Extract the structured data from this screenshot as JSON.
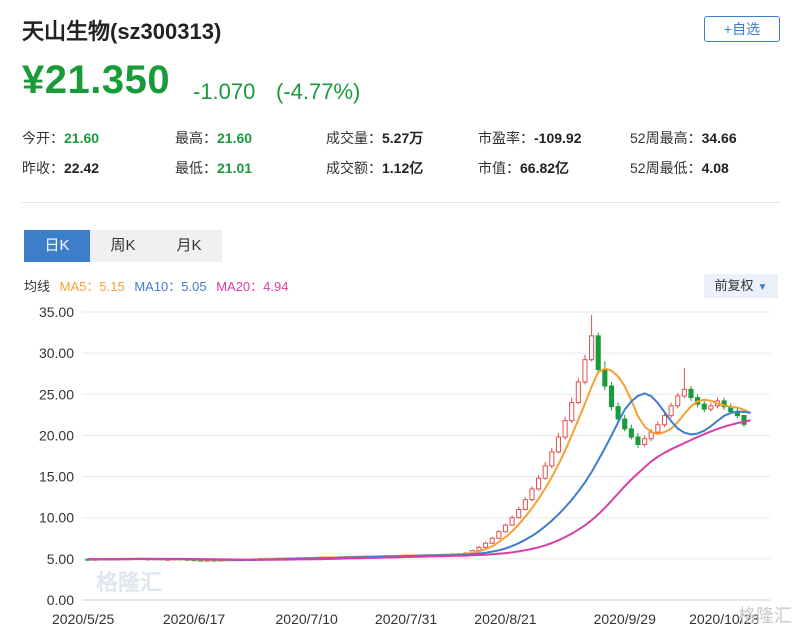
{
  "header": {
    "title": "天山生物(sz300313)",
    "watch_label": "+自选",
    "price": "¥21.350",
    "change": "-1.070",
    "change_pct": "(-4.77%)"
  },
  "stats": [
    {
      "label": "今开：",
      "value": "21.60",
      "color": "#1a9b3a"
    },
    {
      "label": "最高：",
      "value": "21.60",
      "color": "#1a9b3a"
    },
    {
      "label": "成交量：",
      "value": "5.27万",
      "color": "#222222"
    },
    {
      "label": "市盈率：",
      "value": "-109.92",
      "color": "#222222"
    },
    {
      "label": "52周最高：",
      "value": "34.66",
      "color": "#222222"
    },
    {
      "label": "昨收：",
      "value": "22.42",
      "color": "#222222"
    },
    {
      "label": "最低：",
      "value": "21.01",
      "color": "#1a9b3a"
    },
    {
      "label": "成交额：",
      "value": "1.12亿",
      "color": "#222222"
    },
    {
      "label": "市值：",
      "value": "66.82亿",
      "color": "#222222"
    },
    {
      "label": "52周最低：",
      "value": "4.08",
      "color": "#222222"
    }
  ],
  "tabs": [
    "日K",
    "周K",
    "月K"
  ],
  "legend": {
    "label": "均线",
    "ma5": "MA5：5.15",
    "ma10": "MA10：5.05",
    "ma20": "MA20：4.94",
    "ma5_color": "#f5a033",
    "ma10_color": "#3d7ecb",
    "ma20_color": "#d63fa8"
  },
  "adjust_label": "前复权",
  "watermarks": [
    "格隆汇",
    "格隆汇"
  ],
  "chart_data": {
    "type": "candlestick",
    "yticks": [
      "35.00",
      "30.00",
      "25.00",
      "20.00",
      "15.00",
      "10.00",
      "5.00",
      "0.00"
    ],
    "ylim": [
      0,
      35
    ],
    "xticks": [
      {
        "label": "2020/5/25",
        "i": 0
      },
      {
        "label": "2020/6/17",
        "i": 16
      },
      {
        "label": "2020/7/10",
        "i": 33
      },
      {
        "label": "2020/7/31",
        "i": 48
      },
      {
        "label": "2020/8/21",
        "i": 63
      },
      {
        "label": "2020/9/29",
        "i": 81
      },
      {
        "label": "2020/10/28",
        "i": 96
      }
    ],
    "candles": [
      [
        4.95,
        4.9,
        5.05,
        4.85
      ],
      [
        4.9,
        4.95,
        5.0,
        4.85
      ],
      [
        4.95,
        5.0,
        5.05,
        4.9
      ],
      [
        5.0,
        4.95,
        5.05,
        4.9
      ],
      [
        4.95,
        5.0,
        5.05,
        4.9
      ],
      [
        5.0,
        5.05,
        5.1,
        4.95
      ],
      [
        5.05,
        5.0,
        5.1,
        4.95
      ],
      [
        5.0,
        5.05,
        5.1,
        4.95
      ],
      [
        5.05,
        5.0,
        5.1,
        4.95
      ],
      [
        5.0,
        4.95,
        5.05,
        4.9
      ],
      [
        4.95,
        5.0,
        5.05,
        4.9
      ],
      [
        5.0,
        4.95,
        5.05,
        4.9
      ],
      [
        4.95,
        4.95,
        5.0,
        4.9
      ],
      [
        4.95,
        5.0,
        5.05,
        4.9
      ],
      [
        5.0,
        4.95,
        5.05,
        4.9
      ],
      [
        4.95,
        4.9,
        5.0,
        4.85
      ],
      [
        4.9,
        4.85,
        4.95,
        4.8
      ],
      [
        4.85,
        4.8,
        4.9,
        4.75
      ],
      [
        4.8,
        4.85,
        4.9,
        4.75
      ],
      [
        4.85,
        4.8,
        4.9,
        4.75
      ],
      [
        4.8,
        4.85,
        4.9,
        4.75
      ],
      [
        4.85,
        4.9,
        4.95,
        4.8
      ],
      [
        4.9,
        4.85,
        4.95,
        4.8
      ],
      [
        4.85,
        4.9,
        4.95,
        4.8
      ],
      [
        4.9,
        4.95,
        5.0,
        4.85
      ],
      [
        4.95,
        5.0,
        5.05,
        4.9
      ],
      [
        5.0,
        5.05,
        5.1,
        4.95
      ],
      [
        5.05,
        5.0,
        5.1,
        4.95
      ],
      [
        5.0,
        5.05,
        5.1,
        4.95
      ],
      [
        5.05,
        5.1,
        5.15,
        5.0
      ],
      [
        5.1,
        5.05,
        5.15,
        5.0
      ],
      [
        5.05,
        5.1,
        5.15,
        5.0
      ],
      [
        5.1,
        5.15,
        5.2,
        5.05
      ],
      [
        5.15,
        5.1,
        5.2,
        5.05
      ],
      [
        5.1,
        5.15,
        5.2,
        5.05
      ],
      [
        5.15,
        5.2,
        5.25,
        5.1
      ],
      [
        5.2,
        5.15,
        5.25,
        5.1
      ],
      [
        5.15,
        5.2,
        5.25,
        5.1
      ],
      [
        5.2,
        5.25,
        5.3,
        5.15
      ],
      [
        5.25,
        5.3,
        5.35,
        5.2
      ],
      [
        5.3,
        5.25,
        5.35,
        5.2
      ],
      [
        5.25,
        5.3,
        5.35,
        5.2
      ],
      [
        5.3,
        5.35,
        5.4,
        5.25
      ],
      [
        5.35,
        5.3,
        5.4,
        5.25
      ],
      [
        5.3,
        5.35,
        5.4,
        5.25
      ],
      [
        5.35,
        5.4,
        5.45,
        5.3
      ],
      [
        5.4,
        5.35,
        5.45,
        5.3
      ],
      [
        5.35,
        5.4,
        5.45,
        5.3
      ],
      [
        5.4,
        5.45,
        5.5,
        5.35
      ],
      [
        5.45,
        5.4,
        5.5,
        5.35
      ],
      [
        5.4,
        5.45,
        5.5,
        5.35
      ],
      [
        5.45,
        5.5,
        5.55,
        5.4
      ],
      [
        5.5,
        5.45,
        5.55,
        5.4
      ],
      [
        5.45,
        5.5,
        5.55,
        5.4
      ],
      [
        5.5,
        5.55,
        5.6,
        5.45
      ],
      [
        5.55,
        5.6,
        5.7,
        5.5
      ],
      [
        5.6,
        5.55,
        5.7,
        5.5
      ],
      [
        5.55,
        5.7,
        5.8,
        5.5
      ],
      [
        5.7,
        6.0,
        6.1,
        5.65
      ],
      [
        6.0,
        6.4,
        6.6,
        5.95
      ],
      [
        6.4,
        6.9,
        7.1,
        6.3
      ],
      [
        6.9,
        7.5,
        7.7,
        6.8
      ],
      [
        7.5,
        8.3,
        8.5,
        7.4
      ],
      [
        8.3,
        9.1,
        9.3,
        8.2
      ],
      [
        9.1,
        10.0,
        10.3,
        9.0
      ],
      [
        10.0,
        11.0,
        11.3,
        9.9
      ],
      [
        11.0,
        12.2,
        12.5,
        10.9
      ],
      [
        12.2,
        13.5,
        13.8,
        12.0
      ],
      [
        13.5,
        14.8,
        15.2,
        13.3
      ],
      [
        14.8,
        16.3,
        16.8,
        14.6
      ],
      [
        16.3,
        18.0,
        18.5,
        16.0
      ],
      [
        18.0,
        19.8,
        20.3,
        17.8
      ],
      [
        19.8,
        21.8,
        22.3,
        19.5
      ],
      [
        21.8,
        24.0,
        24.6,
        21.5
      ],
      [
        24.0,
        26.5,
        27.0,
        23.8
      ],
      [
        26.5,
        29.2,
        29.8,
        26.2
      ],
      [
        29.2,
        32.1,
        34.66,
        29.0
      ],
      [
        32.1,
        28.0,
        32.5,
        27.5
      ],
      [
        28.0,
        26.0,
        29.0,
        25.5
      ],
      [
        26.0,
        23.5,
        26.5,
        23.0
      ],
      [
        23.5,
        22.0,
        24.0,
        21.5
      ],
      [
        22.0,
        20.8,
        22.5,
        20.5
      ],
      [
        20.8,
        19.8,
        21.3,
        19.5
      ],
      [
        19.8,
        18.9,
        20.3,
        18.5
      ],
      [
        18.9,
        19.6,
        20.0,
        18.6
      ],
      [
        19.6,
        20.4,
        20.8,
        19.3
      ],
      [
        20.4,
        21.3,
        21.7,
        20.1
      ],
      [
        21.3,
        22.4,
        22.8,
        21.0
      ],
      [
        22.4,
        23.6,
        24.0,
        22.1
      ],
      [
        23.6,
        24.8,
        25.2,
        23.3
      ],
      [
        24.8,
        25.6,
        28.2,
        24.5
      ],
      [
        25.6,
        24.6,
        26.0,
        24.2
      ],
      [
        24.6,
        23.8,
        25.0,
        23.4
      ],
      [
        23.8,
        23.2,
        24.2,
        22.8
      ],
      [
        23.2,
        23.6,
        24.0,
        22.9
      ],
      [
        23.6,
        24.2,
        24.6,
        23.3
      ],
      [
        24.2,
        23.5,
        24.6,
        23.1
      ],
      [
        23.5,
        22.9,
        23.9,
        22.6
      ],
      [
        22.9,
        22.4,
        23.3,
        22.1
      ],
      [
        22.42,
        21.35,
        21.6,
        21.01
      ]
    ],
    "ma": [
      {
        "name": "MA5",
        "color": "#f5a033",
        "values": [
          4.95,
          4.95,
          4.96,
          4.97,
          4.97,
          4.99,
          5.0,
          5.02,
          5.02,
          5.01,
          5.0,
          4.99,
          4.97,
          4.97,
          4.97,
          4.95,
          4.92,
          4.9,
          4.88,
          4.86,
          4.82,
          4.84,
          4.86,
          4.86,
          4.88,
          4.92,
          4.97,
          5.0,
          5.02,
          5.04,
          5.06,
          5.08,
          5.09,
          5.1,
          5.12,
          5.14,
          5.16,
          5.17,
          5.18,
          5.22,
          5.24,
          5.26,
          5.28,
          5.29,
          5.31,
          5.33,
          5.35,
          5.36,
          5.38,
          5.4,
          5.42,
          5.43,
          5.46,
          5.47,
          5.49,
          5.52,
          5.56,
          5.59,
          5.7,
          5.89,
          6.18,
          6.53,
          7.02,
          7.64,
          8.35,
          9.18,
          10.12,
          11.16,
          12.3,
          13.56,
          14.92,
          16.48,
          18.14,
          19.98,
          21.92,
          23.86,
          25.92,
          27.7,
          28.12,
          27.86,
          27.16,
          25.98,
          24.26,
          22.32,
          21.08,
          20.42,
          20.18,
          20.4,
          20.82,
          21.62,
          22.62,
          23.54,
          24.14,
          24.36,
          24.22,
          23.88,
          23.66,
          23.48,
          23.38,
          23.12,
          22.68
        ]
      },
      {
        "name": "MA10",
        "color": "#3d7ecb",
        "values": [
          4.95,
          4.95,
          4.96,
          4.96,
          4.96,
          4.96,
          4.97,
          4.98,
          4.99,
          4.99,
          4.99,
          4.99,
          4.99,
          4.99,
          4.99,
          4.98,
          4.97,
          4.95,
          4.94,
          4.92,
          4.9,
          4.88,
          4.87,
          4.86,
          4.86,
          4.86,
          4.88,
          4.91,
          4.93,
          4.96,
          4.98,
          5.0,
          5.02,
          5.04,
          5.06,
          5.08,
          5.1,
          5.12,
          5.14,
          5.16,
          5.18,
          5.2,
          5.22,
          5.24,
          5.26,
          5.28,
          5.3,
          5.32,
          5.34,
          5.35,
          5.37,
          5.39,
          5.41,
          5.43,
          5.44,
          5.46,
          5.49,
          5.51,
          5.56,
          5.64,
          5.75,
          5.88,
          6.04,
          6.26,
          6.55,
          6.9,
          7.32,
          7.79,
          8.33,
          8.96,
          9.65,
          10.41,
          11.25,
          12.17,
          13.19,
          14.3,
          15.56,
          16.96,
          18.42,
          19.99,
          21.6,
          23.13,
          24.13,
          24.81,
          25.11,
          24.77,
          23.93,
          22.84,
          21.73,
          20.84,
          20.33,
          20.13,
          20.24,
          20.58,
          21.12,
          21.77,
          22.38,
          22.74,
          22.89,
          22.86,
          22.75
        ]
      },
      {
        "name": "MA20",
        "color": "#d63fa8",
        "values": [
          4.95,
          4.95,
          4.95,
          4.96,
          4.96,
          4.96,
          4.96,
          4.97,
          4.97,
          4.97,
          4.97,
          4.97,
          4.97,
          4.97,
          4.97,
          4.97,
          4.97,
          4.96,
          4.96,
          4.95,
          4.94,
          4.93,
          4.92,
          4.91,
          4.91,
          4.9,
          4.9,
          4.9,
          4.9,
          4.91,
          4.91,
          4.92,
          4.93,
          4.94,
          4.95,
          4.96,
          4.98,
          5.0,
          5.02,
          5.04,
          5.06,
          5.08,
          5.1,
          5.12,
          5.14,
          5.16,
          5.18,
          5.2,
          5.22,
          5.24,
          5.26,
          5.28,
          5.3,
          5.32,
          5.34,
          5.36,
          5.38,
          5.4,
          5.43,
          5.47,
          5.51,
          5.56,
          5.62,
          5.7,
          5.79,
          5.91,
          6.05,
          6.21,
          6.41,
          6.64,
          6.93,
          7.26,
          7.64,
          8.06,
          8.54,
          9.08,
          9.7,
          10.4,
          11.19,
          12.05,
          12.94,
          13.82,
          14.64,
          15.4,
          16.14,
          16.83,
          17.42,
          17.9,
          18.31,
          18.69,
          19.07,
          19.44,
          19.81,
          20.15,
          20.49,
          20.79,
          21.06,
          21.29,
          21.5,
          21.68,
          21.83
        ]
      }
    ]
  }
}
